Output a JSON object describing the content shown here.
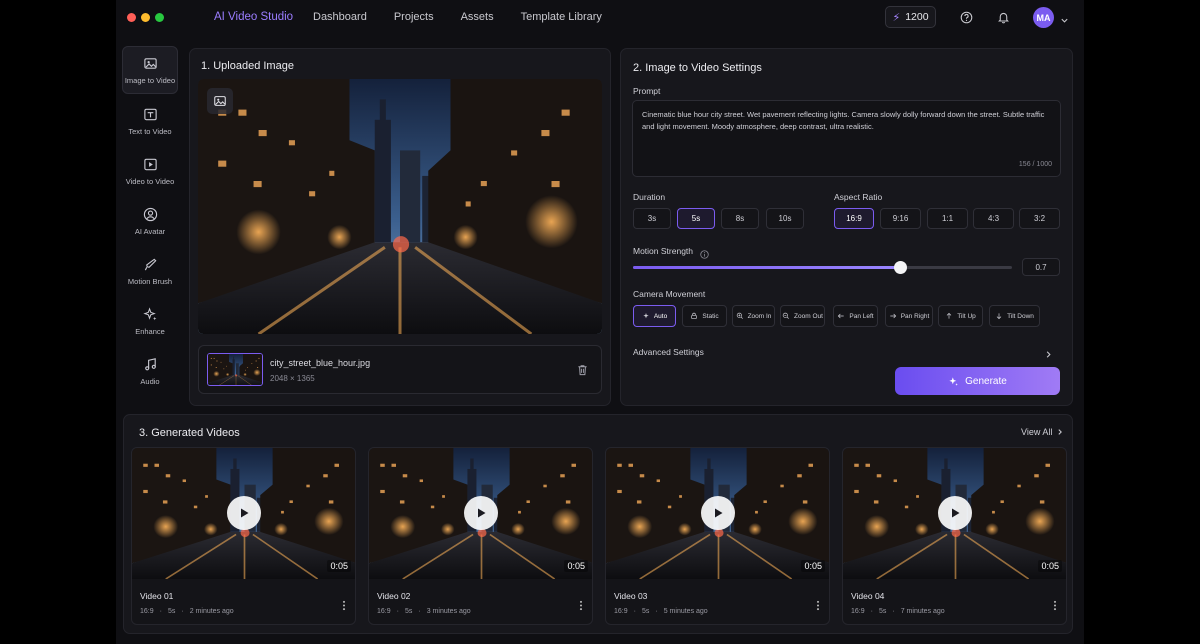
{
  "app": {
    "brand": "AI Video Studio",
    "nav": [
      "Dashboard",
      "Projects",
      "Assets",
      "Template Library"
    ],
    "credits": "1200",
    "avatar_initials": "MA",
    "accent": "#7b5cf0"
  },
  "sidebar": {
    "items": [
      {
        "label": "Image to Video",
        "icon": "image-icon",
        "active": true
      },
      {
        "label": "Text to Video",
        "icon": "text-video-icon"
      },
      {
        "label": "Video to Video",
        "icon": "video-icon"
      },
      {
        "label": "AI Avatar",
        "icon": "avatar-icon"
      },
      {
        "label": "Motion Brush",
        "icon": "brush-icon"
      },
      {
        "label": "Enhance",
        "icon": "sparkle-icon"
      },
      {
        "label": "Audio",
        "icon": "music-icon"
      }
    ]
  },
  "upload": {
    "title": "1. Uploaded Image",
    "file_name": "city_street_blue_hour.jpg",
    "file_dimensions": "2048 × 1365"
  },
  "settings": {
    "title": "2. Image to Video Settings",
    "prompt_label": "Prompt",
    "prompt_text": "Cinematic blue hour city street. Wet pavement reflecting lights. Camera slowly dolly forward down the street. Subtle traffic and light movement. Moody atmosphere, deep contrast, ultra realistic.",
    "prompt_counter": "156 / 1000",
    "duration_label": "Duration",
    "durations": [
      "3s",
      "5s",
      "8s",
      "10s"
    ],
    "duration_selected": "5s",
    "aspect_label": "Aspect Ratio",
    "aspects": [
      "16:9",
      "9:16",
      "1:1",
      "4:3",
      "3:2"
    ],
    "aspect_selected": "16:9",
    "motion_label": "Motion Strength",
    "motion_value": "0.7",
    "camera_label": "Camera Movement",
    "camera_moves": [
      {
        "label": "Auto",
        "icon": "sparkle-icon"
      },
      {
        "label": "Static",
        "icon": "lock-icon"
      },
      {
        "label": "Zoom In",
        "icon": "zoom-in-icon"
      },
      {
        "label": "Zoom Out",
        "icon": "zoom-out-icon"
      },
      {
        "label": "Pan Left",
        "icon": "arrow-left-icon"
      },
      {
        "label": "Pan Right",
        "icon": "arrow-right-icon"
      },
      {
        "label": "Tilt Up",
        "icon": "arrow-up-icon"
      },
      {
        "label": "Tilt Down",
        "icon": "arrow-down-icon"
      }
    ],
    "camera_selected": "Auto",
    "advanced_label": "Advanced Settings",
    "generate_label": "Generate"
  },
  "generated": {
    "title": "3. Generated Videos",
    "view_all": "View All",
    "videos": [
      {
        "title": "Video 01",
        "ratio": "16:9",
        "length": "5s",
        "time": "2 minutes ago",
        "duration": "0:05"
      },
      {
        "title": "Video 02",
        "ratio": "16:9",
        "length": "5s",
        "time": "3 minutes ago",
        "duration": "0:05"
      },
      {
        "title": "Video 03",
        "ratio": "16:9",
        "length": "5s",
        "time": "5 minutes ago",
        "duration": "0:05"
      },
      {
        "title": "Video 04",
        "ratio": "16:9",
        "length": "5s",
        "time": "7 minutes ago",
        "duration": "0:05"
      }
    ]
  }
}
